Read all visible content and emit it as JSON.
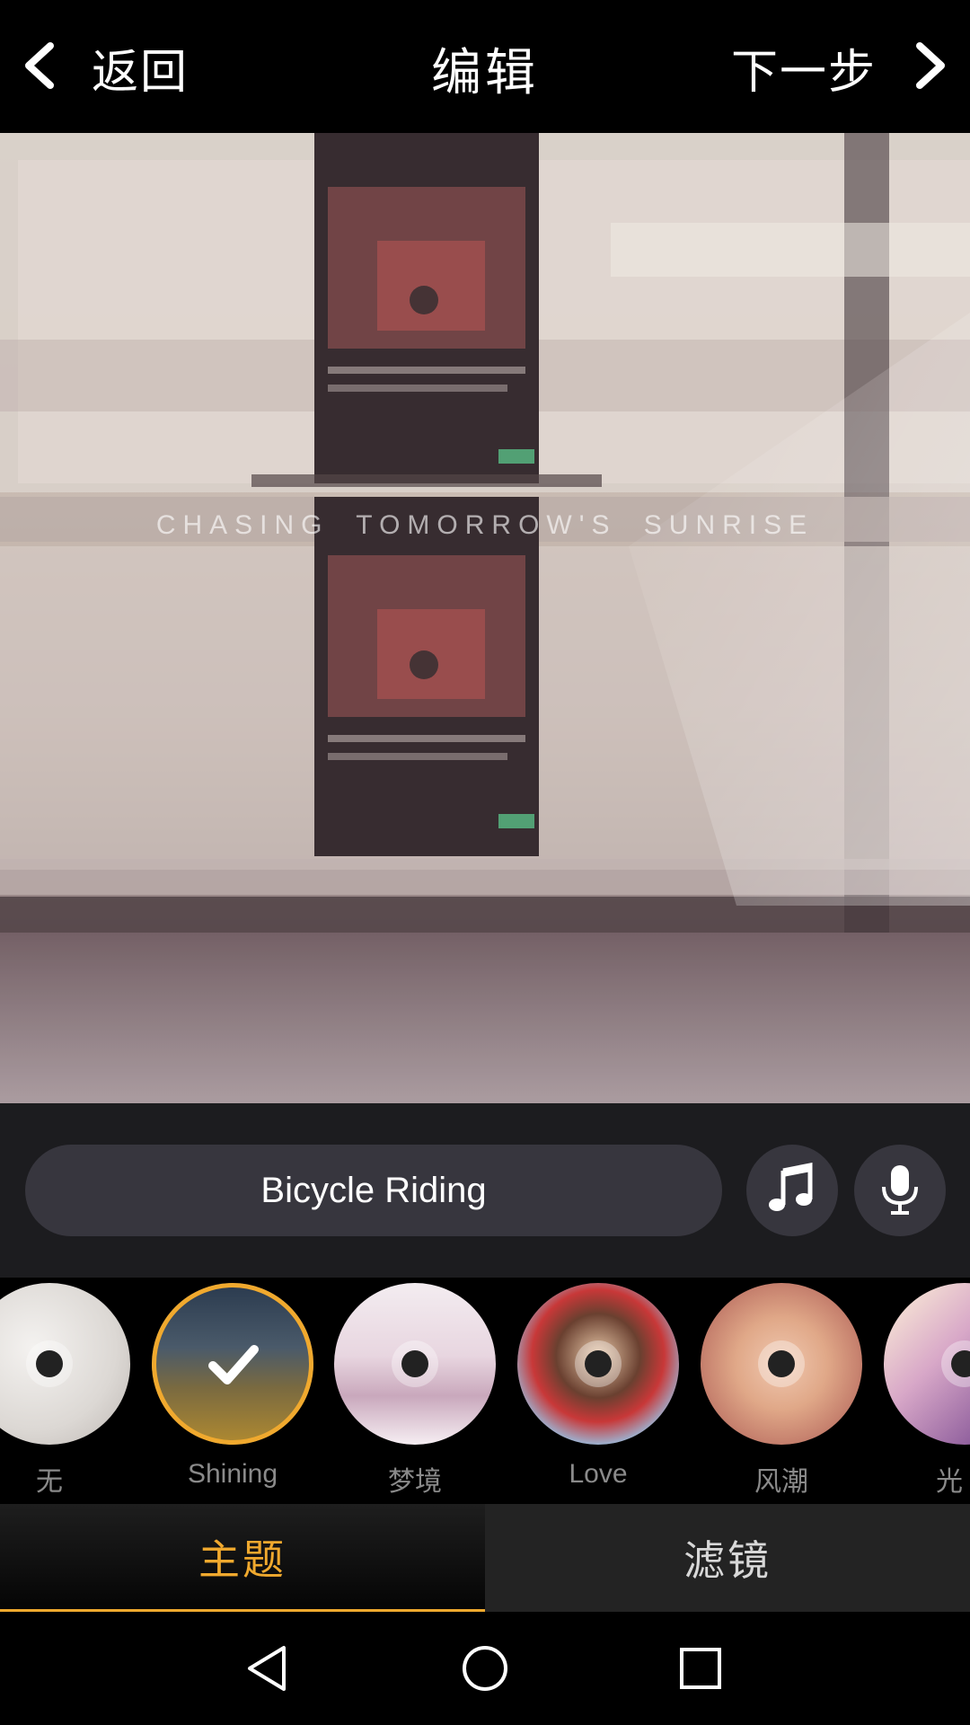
{
  "header": {
    "back_label": "返回",
    "title": "编辑",
    "next_label": "下一步"
  },
  "preview": {
    "overlay_text": "CHASING TOMORROW'S SUNRISE"
  },
  "music_bar": {
    "track_name": "Bicycle Riding",
    "music_icon": "music-note-icon",
    "mic_icon": "microphone-icon"
  },
  "themes": [
    {
      "label": "无",
      "selected": false
    },
    {
      "label": "Shining",
      "selected": true
    },
    {
      "label": "梦境",
      "selected": false
    },
    {
      "label": "Love",
      "selected": false
    },
    {
      "label": "风潮",
      "selected": false
    },
    {
      "label": "光",
      "selected": false
    }
  ],
  "tabs": [
    {
      "label": "主题",
      "active": true
    },
    {
      "label": "滤镜",
      "active": false
    }
  ],
  "colors": {
    "accent": "#f0a92e",
    "pill_bg": "#37363e",
    "controls_bg": "#1c1c1f"
  }
}
